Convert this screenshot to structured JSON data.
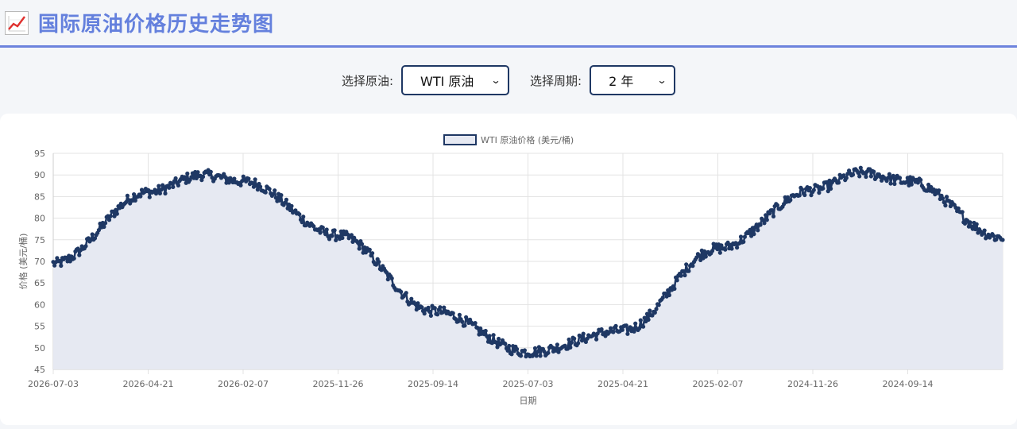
{
  "header": {
    "icon": "chart-increasing-icon",
    "title": "国际原油价格历史走势图"
  },
  "controls": {
    "oil_label": "选择原油:",
    "oil_value": "WTI 原油",
    "period_label": "选择周期:",
    "period_value": "2 年"
  },
  "colors": {
    "accent": "#6480dd",
    "series": "#1f3864",
    "fill": "#e6e9f2"
  },
  "chart_data": {
    "type": "line",
    "legend": "WTI 原油价格 (美元/桶)",
    "legend_position": "top-center",
    "xlabel": "日期",
    "ylabel": "价格 (美元/桶)",
    "ylim": [
      45,
      95
    ],
    "yticks": [
      45,
      50,
      55,
      60,
      65,
      70,
      75,
      80,
      85,
      90,
      95
    ],
    "x_tick_labels": [
      "2026-07-03",
      "2026-04-21",
      "2026-02-07",
      "2025-11-26",
      "2025-09-14",
      "2025-07-03",
      "2025-04-21",
      "2025-02-07",
      "2024-11-26",
      "2024-09-14"
    ],
    "grid": true,
    "fill": true,
    "num_points": 730,
    "series": [
      {
        "name": "WTI 原油价格 (美元/桶)",
        "key_points": [
          {
            "x": "2026-07-03",
            "y": 69.5
          },
          {
            "x": "2026-04-21",
            "y": 86.0
          },
          {
            "x": "2026-03-10",
            "y": 90.0
          },
          {
            "x": "2026-02-07",
            "y": 88.5
          },
          {
            "x": "2025-11-26",
            "y": 76.0
          },
          {
            "x": "2025-09-14",
            "y": 58.5
          },
          {
            "x": "2025-07-03",
            "y": 49.0
          },
          {
            "x": "2025-04-21",
            "y": 54.0
          },
          {
            "x": "2025-02-07",
            "y": 73.0
          },
          {
            "x": "2024-11-26",
            "y": 86.5
          },
          {
            "x": "2024-10-20",
            "y": 90.5
          },
          {
            "x": "2024-09-14",
            "y": 88.5
          },
          {
            "x": "2024-07-03",
            "y": 75.5
          }
        ]
      }
    ]
  }
}
